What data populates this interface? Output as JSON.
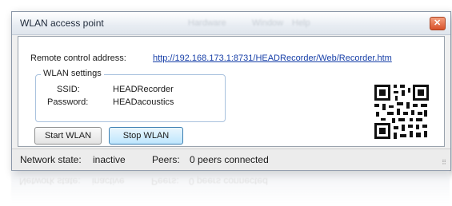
{
  "window": {
    "title": "WLAN access point",
    "close_glyph": "✕"
  },
  "menu_ghost": [
    "Hardware",
    "Window",
    "Help"
  ],
  "remote": {
    "label": "Remote control address:",
    "url": "http://192.168.173.1:8731/HEADRecorder/Web/Recorder.htm"
  },
  "wlan_settings": {
    "title": "WLAN settings",
    "ssid_label": "SSID:",
    "ssid_value": "HEADRecorder",
    "password_label": "Password:",
    "password_value": "HEADacoustics"
  },
  "buttons": {
    "start": "Start WLAN",
    "stop": "Stop WLAN"
  },
  "status": {
    "network_label": "Network state:",
    "network_value": "inactive",
    "peers_label": "Peers:",
    "peers_value": "0 peers connected"
  },
  "icons": {
    "qr": "qr-code-icon",
    "grip": "resize-grip-icon",
    "close": "close-icon"
  }
}
